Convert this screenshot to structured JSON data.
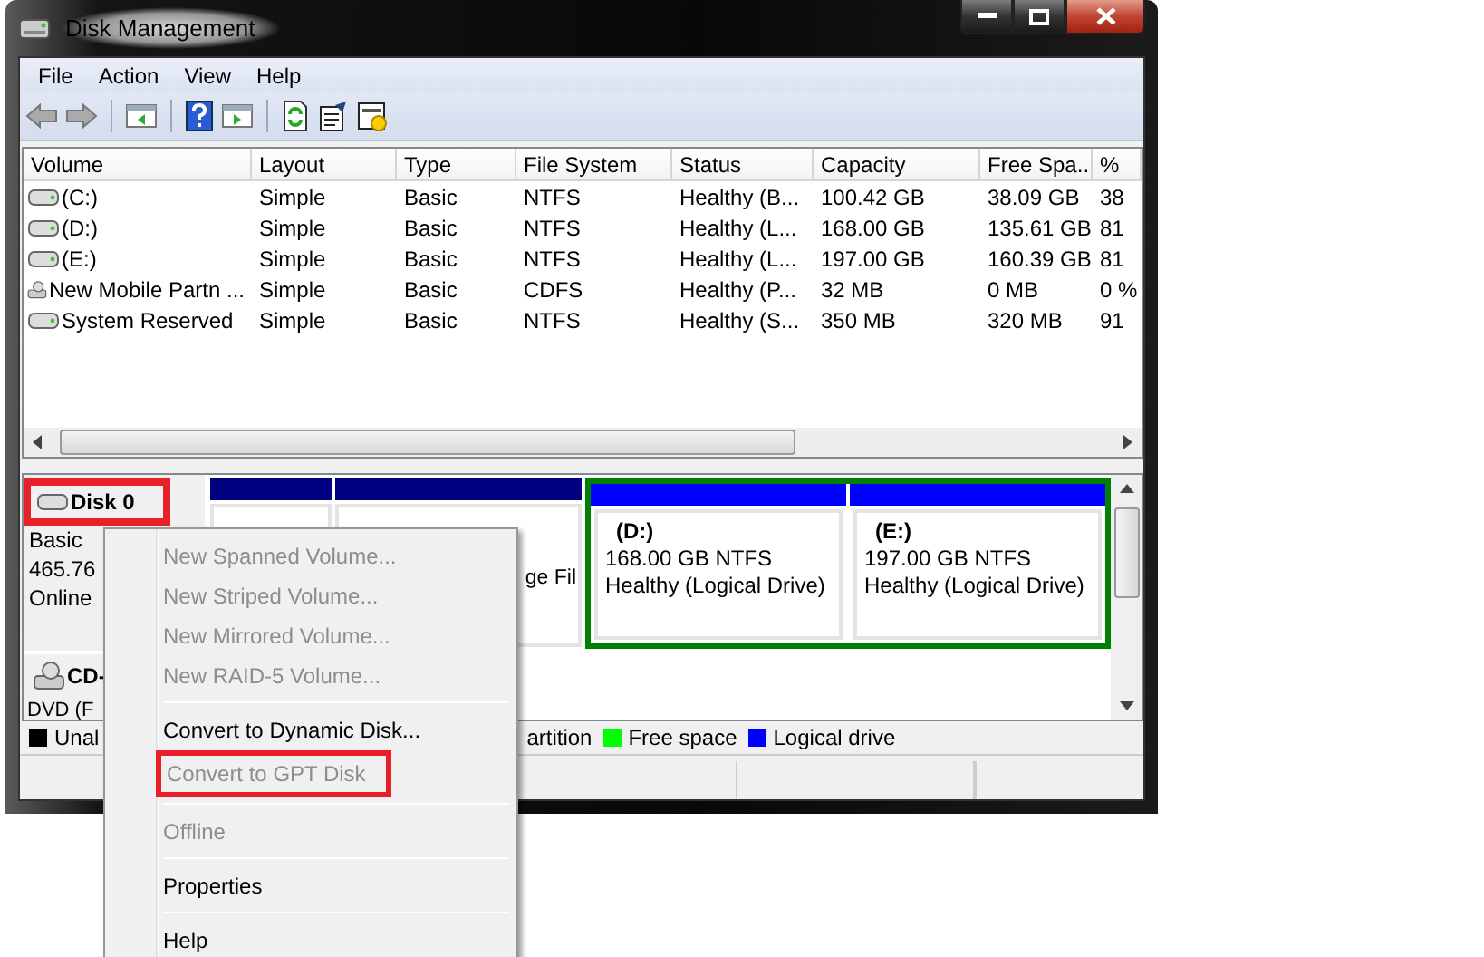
{
  "window": {
    "title": "Disk Management"
  },
  "menu": [
    "File",
    "Action",
    "View",
    "Help"
  ],
  "volume_table": {
    "columns": [
      "Volume",
      "Layout",
      "Type",
      "File System",
      "Status",
      "Capacity",
      "Free Spa...",
      "%"
    ],
    "rows": [
      {
        "kind": "disk",
        "cells": [
          "(C:)",
          "Simple",
          "Basic",
          "NTFS",
          "Healthy (B...",
          "100.42 GB",
          "38.09 GB",
          "38"
        ]
      },
      {
        "kind": "disk",
        "cells": [
          "(D:)",
          "Simple",
          "Basic",
          "NTFS",
          "Healthy (L...",
          "168.00 GB",
          "135.61 GB",
          "81"
        ]
      },
      {
        "kind": "disk",
        "cells": [
          "(E:)",
          "Simple",
          "Basic",
          "NTFS",
          "Healthy (L...",
          "197.00 GB",
          "160.39 GB",
          "81"
        ]
      },
      {
        "kind": "mobile",
        "cells": [
          "New Mobile Partn ...",
          "Simple",
          "Basic",
          "CDFS",
          "Healthy (P...",
          "32 MB",
          "0 MB",
          "0 %"
        ]
      },
      {
        "kind": "disk",
        "cells": [
          "System Reserved",
          "Simple",
          "Basic",
          "NTFS",
          "Healthy (S...",
          "350 MB",
          "320 MB",
          "91"
        ]
      }
    ]
  },
  "disks": [
    {
      "kind": "disk",
      "name": "Disk 0",
      "highlighted": true,
      "lines": [
        "Basic",
        "465.76",
        "Online"
      ],
      "partitions": [
        {
          "kind": "primary",
          "color": "#000080"
        },
        {
          "kind": "primary",
          "color": "#000080",
          "lines": [
            "ge Fil"
          ]
        },
        {
          "kind": "extended",
          "color": "#008000",
          "children": [
            {
              "kind": "logical",
              "color": "#0000ff",
              "lines": [
                "(D:)",
                "168.00 GB NTFS",
                "Healthy (Logical Drive)"
              ]
            },
            {
              "kind": "logical",
              "color": "#0000ff",
              "lines": [
                "(E:)",
                "197.00 GB NTFS",
                "Healthy (Logical Drive)"
              ]
            }
          ]
        }
      ]
    },
    {
      "kind": "cdrom",
      "name": "CD-",
      "highlighted": false,
      "lines": [
        "DVD (F"
      ]
    }
  ],
  "legend": [
    {
      "label": "Unal",
      "color": "#000000"
    },
    {
      "label": "artition"
    },
    {
      "label": "Free space",
      "color": "#00ff00"
    },
    {
      "label": "Logical drive",
      "color": "#0000ff"
    }
  ],
  "context_menu": {
    "groups": [
      [
        {
          "label": "New Spanned Volume...",
          "disabled": true,
          "highlighted": false
        },
        {
          "label": "New Striped Volume...",
          "disabled": true,
          "highlighted": false
        },
        {
          "label": "New Mirrored Volume...",
          "disabled": true,
          "highlighted": false
        },
        {
          "label": "New RAID-5 Volume...",
          "disabled": true,
          "highlighted": false
        }
      ],
      [
        {
          "label": "Convert to Dynamic Disk...",
          "disabled": false,
          "highlighted": false
        },
        {
          "label": "Convert to GPT Disk",
          "disabled": true,
          "highlighted": true
        }
      ],
      [
        {
          "label": "Offline",
          "disabled": true,
          "highlighted": false
        }
      ],
      [
        {
          "label": "Properties",
          "disabled": false,
          "highlighted": false
        }
      ],
      [
        {
          "label": "Help",
          "disabled": false,
          "highlighted": false
        }
      ]
    ]
  }
}
